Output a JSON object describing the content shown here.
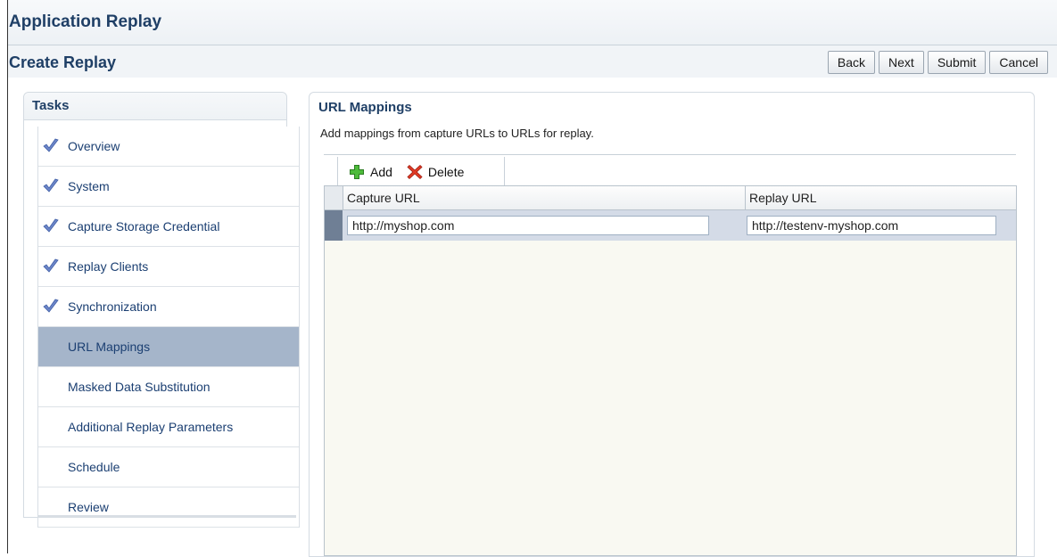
{
  "app": {
    "title": "Application Replay"
  },
  "page": {
    "title": "Create Replay"
  },
  "buttons": {
    "back": "Back",
    "next": "Next",
    "submit": "Submit",
    "cancel": "Cancel"
  },
  "tasks": {
    "title": "Tasks",
    "items": [
      {
        "label": "Overview",
        "completed": true
      },
      {
        "label": "System",
        "completed": true
      },
      {
        "label": "Capture Storage Credential",
        "completed": true
      },
      {
        "label": "Replay Clients",
        "completed": true
      },
      {
        "label": "Synchronization",
        "completed": true
      },
      {
        "label": "URL Mappings",
        "selected": true
      },
      {
        "label": "Masked Data Substitution"
      },
      {
        "label": "Additional Replay Parameters"
      },
      {
        "label": "Schedule"
      },
      {
        "label": "Review"
      }
    ]
  },
  "main": {
    "title": "URL Mappings",
    "description": "Add mappings from capture URLs to URLs for replay.",
    "toolbar": {
      "add": "Add",
      "delete": "Delete"
    },
    "table": {
      "columns": [
        "Capture URL",
        "Replay URL"
      ],
      "rows": [
        {
          "capture_url": "http://myshop.com",
          "replay_url": "http://testenv-myshop.com"
        }
      ]
    }
  },
  "colors": {
    "heading": "#1f3f66",
    "task_link": "#1b3f72",
    "selected_task": "#a5b5ca",
    "selected_row": "#d4dbe7",
    "check": "#6d86c8"
  }
}
